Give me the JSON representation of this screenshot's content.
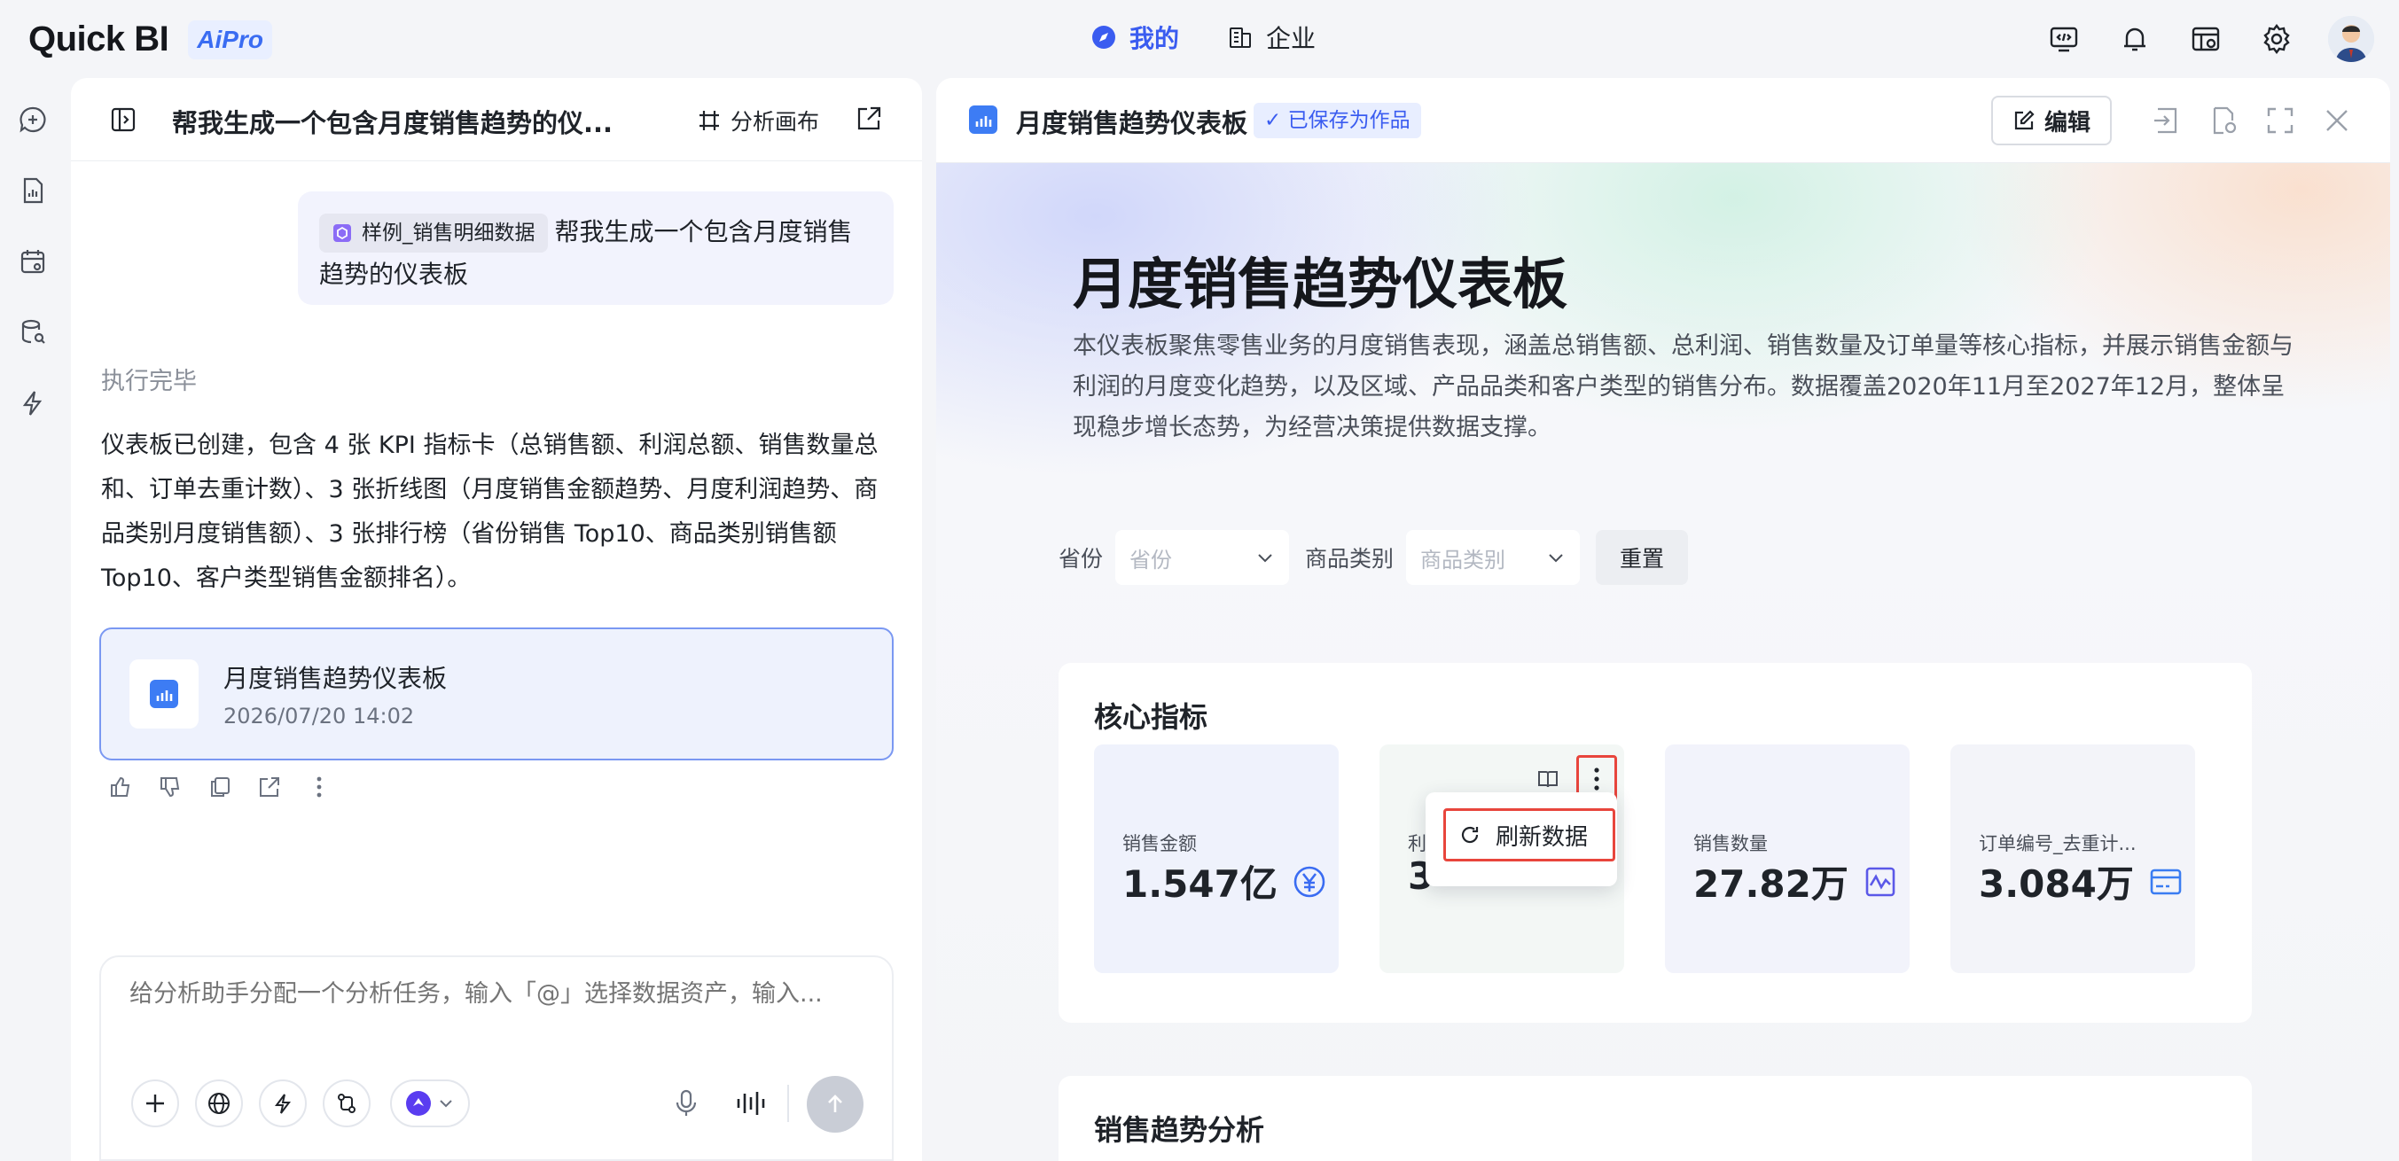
{
  "app": {
    "brand": "Quick BI",
    "brand_badge": "AiPro"
  },
  "nav": {
    "mine": "我的",
    "enterprise": "企业"
  },
  "top_tools": [
    "devtools-icon",
    "bell-icon",
    "dataset-settings-icon",
    "gear-icon"
  ],
  "rail": [
    "chat-plus-icon",
    "report-icon",
    "calendar-icon",
    "database-search-icon",
    "lightning-icon"
  ],
  "chat": {
    "title": "帮我生成一个包含月度销售趋势的仪...",
    "canvas_label": "分析画布",
    "user_message": {
      "dataset_chip": "样例_销售明细数据",
      "text": "帮我生成一个包含月度销售趋势的仪表板"
    },
    "status": "执行完毕",
    "answer": "仪表板已创建，包含 4 张 KPI 指标卡（总销售额、利润总额、销售数量总和、订单去重计数）、3 张折线图（月度销售金额趋势、月度利润趋势、商品类别月度销售额）、3 张排行榜（省份销售 Top10、商品类别销售额 Top10、客户类型销售金额排名）。",
    "artifact": {
      "name": "月度销售趋势仪表板",
      "time": "2026/07/20 14:02"
    },
    "composer": {
      "placeholder": "给分析助手分配一个分析任务，输入「@」选择数据资产，输入..."
    }
  },
  "dashboard": {
    "title": "月度销售趋势仪表板",
    "saved_badge": "✓ 已保存为作品",
    "edit_label": "编辑",
    "hero_title": "月度销售趋势仪表板",
    "hero_desc": "本仪表板聚焦零售业务的月度销售表现，涵盖总销售额、总利润、销售数量及订单量等核心指标，并展示销售金额与利润的月度变化趋势，以及区域、产品品类和客户类型的销售分布。数据覆盖2020年11月至2027年12月，整体呈现稳步增长态势，为经营决策提供数据支撑。",
    "filters": {
      "province_label": "省份",
      "province_placeholder": "省份",
      "category_label": "商品类别",
      "category_placeholder": "商品类别",
      "reset_label": "重置"
    },
    "kpi_section_title": "核心指标",
    "kpis": [
      {
        "label": "销售金额",
        "value": "1.547亿",
        "icon": "yuan-icon",
        "bg": "#eff2fc"
      },
      {
        "label": "利",
        "value": "3",
        "icon": "",
        "bg": "#f3f7f5"
      },
      {
        "label": "销售数量",
        "value": "27.82万",
        "icon": "wave-chart-icon",
        "bg": "#f2f3fb"
      },
      {
        "label": "订单编号_去重计...",
        "value": "3.084万",
        "icon": "card-icon",
        "bg": "#f3f4f9"
      }
    ],
    "context_menu": {
      "refresh_label": "刷新数据"
    },
    "trend_section_title": "销售趋势分析"
  },
  "colors": {
    "accent": "#3a5cf0",
    "highlight": "#e8453c",
    "artifact_border": "#7a98f2"
  }
}
